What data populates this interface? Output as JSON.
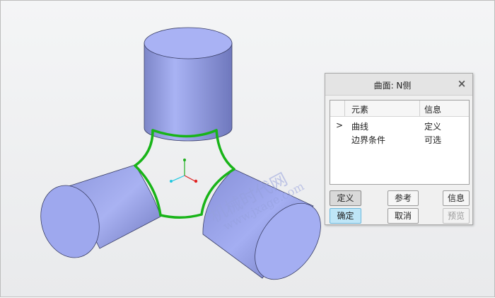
{
  "dialog": {
    "title": "曲面: N侧",
    "close": "×",
    "table": {
      "headers": [
        "元素",
        "信息"
      ],
      "rows": [
        {
          "marker": ">",
          "element": "曲线",
          "info": "定义"
        },
        {
          "marker": "",
          "element": "边界条件",
          "info": "可选"
        }
      ]
    },
    "buttons": {
      "define": "定义",
      "reference": "参考",
      "info": "信息",
      "ok": "确定",
      "cancel": "取消",
      "preview": "预览"
    }
  },
  "watermark": {
    "line1": "机械时代网",
    "line2": "www.jxage.com"
  },
  "colors": {
    "cylinder": "#a4aef2",
    "boundary_curve": "#18b418",
    "axis_x": "#e02020",
    "axis_y": "#20b020",
    "axis_z": "#20c8e0",
    "ok_button": "#bfe6f7"
  },
  "icons": {
    "close": "close-icon",
    "triad": "coordinate-triad-icon"
  }
}
